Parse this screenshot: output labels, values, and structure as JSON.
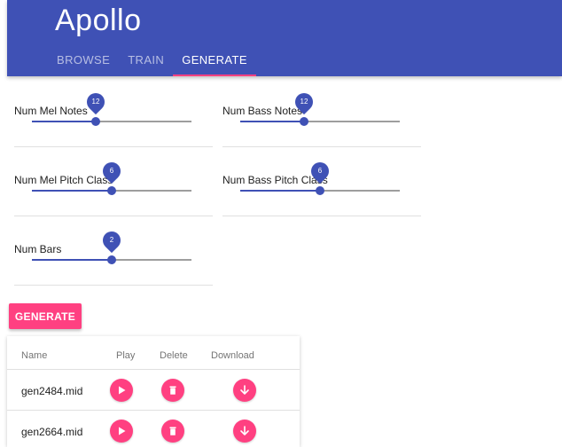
{
  "app": {
    "title": "Apollo"
  },
  "tabs": [
    {
      "label": "BROWSE",
      "active": false
    },
    {
      "label": "TRAIN",
      "active": false
    },
    {
      "label": "GENERATE",
      "active": true
    }
  ],
  "sliders": [
    {
      "label": "Num Mel Notes",
      "value": "12",
      "level": 0.4
    },
    {
      "label": "Num Bass Notes",
      "value": "12",
      "level": 0.4
    },
    {
      "label": "Num Mel Pitch Class",
      "value": "6",
      "level": 0.5
    },
    {
      "label": "Num Bass Pitch Class",
      "value": "6",
      "level": 0.5
    },
    {
      "label": "Num Bars",
      "value": "2",
      "level": 0.5
    }
  ],
  "generate_button": {
    "label": "GENERATE"
  },
  "table": {
    "headers": {
      "name": "Name",
      "play": "Play",
      "delete": "Delete",
      "download": "Download"
    },
    "rows": [
      {
        "name": "gen2484.mid"
      },
      {
        "name": "gen2664.mid"
      }
    ]
  },
  "colors": {
    "primary": "#3f51b5",
    "accent": "#ff4081"
  },
  "icons": {
    "play": "play-icon",
    "delete": "trash-icon",
    "download": "download-arrow-icon"
  }
}
